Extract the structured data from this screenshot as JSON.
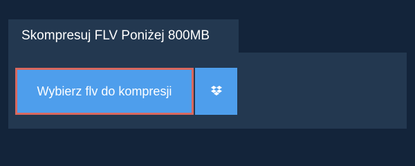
{
  "header": {
    "title": "Skompresuj FLV Poniżej 800MB"
  },
  "uploader": {
    "choose_button_label": "Wybierz flv do kompresji",
    "dropbox_icon": "dropbox-icon"
  },
  "colors": {
    "background": "#13243a",
    "panel": "#233850",
    "button": "#4e9eec",
    "focus_outline": "#d9685e",
    "text": "#ffffff"
  }
}
